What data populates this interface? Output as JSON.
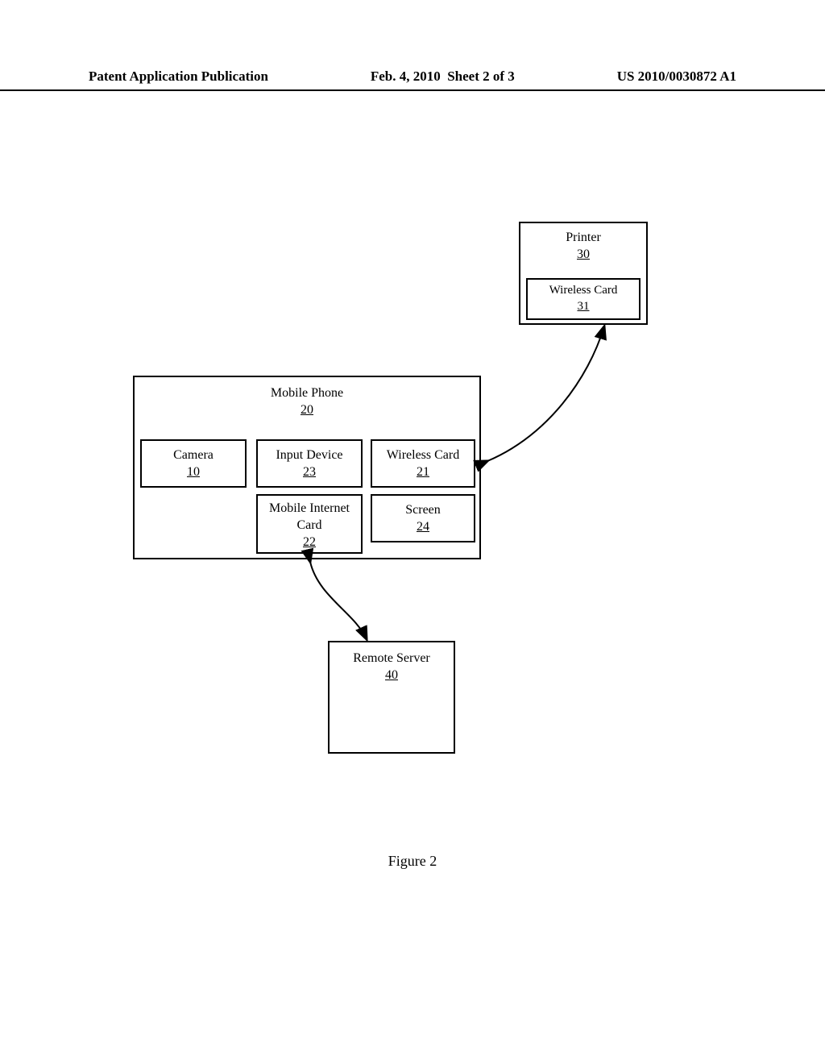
{
  "header": {
    "left": "Patent Application Publication",
    "date": "Feb. 4, 2010",
    "sheet": "Sheet 2 of 3",
    "pubNumber": "US 2010/0030872 A1"
  },
  "figure": {
    "caption": "Figure 2"
  },
  "blocks": {
    "printer": {
      "title": "Printer",
      "ref": "30"
    },
    "printerWireless": {
      "title": "Wireless Card",
      "ref": "31"
    },
    "mobilePhone": {
      "title": "Mobile Phone",
      "ref": "20"
    },
    "camera": {
      "title": "Camera",
      "ref": "10"
    },
    "inputDevice": {
      "title": "Input Device",
      "ref": "23"
    },
    "wirelessCard": {
      "title": "Wireless Card",
      "ref": "21"
    },
    "mobileInternetCard": {
      "title": "Mobile Internet Card",
      "ref": "22"
    },
    "screen": {
      "title": "Screen",
      "ref": "24"
    },
    "remoteServer": {
      "title": "Remote Server",
      "ref": "40"
    }
  }
}
